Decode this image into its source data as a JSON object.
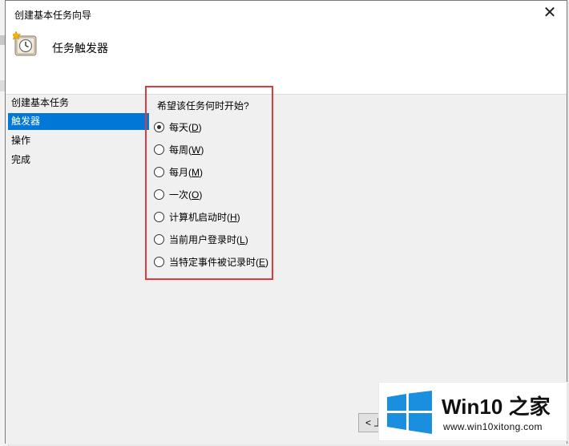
{
  "window": {
    "title": "创建基本任务向导",
    "close_glyph": "✕",
    "header_title": "任务触发器"
  },
  "steps": [
    {
      "label": "创建基本任务"
    },
    {
      "label": "触发器"
    },
    {
      "label": "操作"
    },
    {
      "label": "完成"
    }
  ],
  "question": "希望该任务何时开始?",
  "options": [
    {
      "prefix": "每天(",
      "key": "D",
      "suffix": ")",
      "checked": true
    },
    {
      "prefix": "每周(",
      "key": "W",
      "suffix": ")",
      "checked": false
    },
    {
      "prefix": "每月(",
      "key": "M",
      "suffix": ")",
      "checked": false
    },
    {
      "prefix": "一次(",
      "key": "O",
      "suffix": ")",
      "checked": false
    },
    {
      "prefix": "计算机启动时(",
      "key": "H",
      "suffix": ")",
      "checked": false
    },
    {
      "prefix": "当前用户登录时(",
      "key": "L",
      "suffix": ")",
      "checked": false
    },
    {
      "prefix": "当特定事件被记录时(",
      "key": "E",
      "suffix": ")",
      "checked": false
    }
  ],
  "buttons": {
    "back_label": "< 上"
  },
  "watermark": {
    "name_prefix": "Win10",
    "name_suffix": " 之家",
    "url": "www.win10xitong.com"
  },
  "colors": {
    "selection": "#0078d7",
    "highlight_border": "#e03a3a",
    "logo_blue": "#1a8fe0"
  },
  "icons": {
    "header": "scheduled-task-clock-icon",
    "close": "close-icon",
    "radio_checked": "radio-checked-icon",
    "radio_unchecked": "radio-unchecked-icon",
    "watermark_logo": "windows-logo-icon"
  }
}
